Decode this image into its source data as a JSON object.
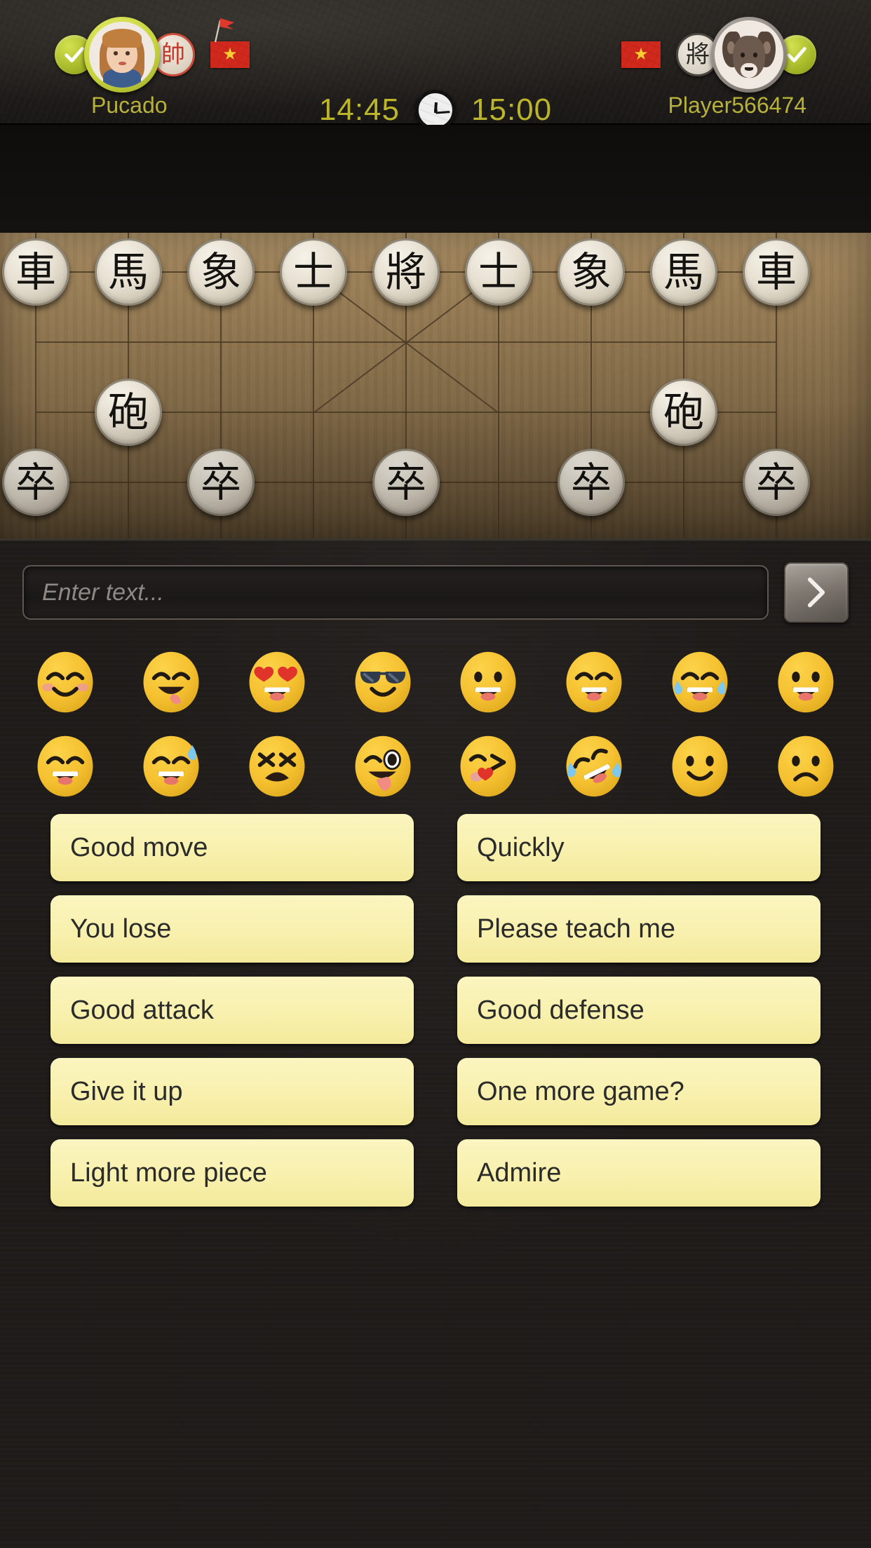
{
  "header": {
    "left_player": {
      "name": "Pucado",
      "piece_badge": "帥",
      "ready_icon": "check-icon",
      "flag": "vietnam-flag",
      "avatar": "girl-avatar",
      "pin_icon": "red-flag-pin-icon"
    },
    "right_player": {
      "name": "Player566474",
      "piece_badge": "將",
      "ready_icon": "check-icon",
      "flag": "vietnam-flag",
      "avatar": "ram-avatar"
    },
    "timers": {
      "left_time": "14:45",
      "right_time": "15:00",
      "clock_icon": "clock-icon"
    },
    "accent_color": "#b9b23a",
    "flag_color": "#d0271c"
  },
  "board": {
    "columns": 9,
    "rows": 10,
    "board_color": "#8b7049",
    "line_color": "#4b3a26",
    "pieces": [
      {
        "glyph": "車",
        "col": 0,
        "row": 0
      },
      {
        "glyph": "馬",
        "col": 1,
        "row": 0
      },
      {
        "glyph": "象",
        "col": 2,
        "row": 0
      },
      {
        "glyph": "士",
        "col": 3,
        "row": 0
      },
      {
        "glyph": "將",
        "col": 4,
        "row": 0
      },
      {
        "glyph": "士",
        "col": 5,
        "row": 0
      },
      {
        "glyph": "象",
        "col": 6,
        "row": 0
      },
      {
        "glyph": "馬",
        "col": 7,
        "row": 0
      },
      {
        "glyph": "車",
        "col": 8,
        "row": 0
      },
      {
        "glyph": "砲",
        "col": 1,
        "row": 2
      },
      {
        "glyph": "砲",
        "col": 7,
        "row": 2
      },
      {
        "glyph": "卒",
        "col": 0,
        "row": 3
      },
      {
        "glyph": "卒",
        "col": 2,
        "row": 3
      },
      {
        "glyph": "卒",
        "col": 4,
        "row": 3
      },
      {
        "glyph": "卒",
        "col": 6,
        "row": 3
      },
      {
        "glyph": "卒",
        "col": 8,
        "row": 3
      }
    ]
  },
  "chat": {
    "input_placeholder": "Enter text...",
    "send_icon": "chevron-right-icon",
    "emoji_rows": [
      [
        {
          "name": "blush-emoji"
        },
        {
          "name": "yum-emoji"
        },
        {
          "name": "heart-eyes-emoji"
        },
        {
          "name": "sunglasses-emoji"
        },
        {
          "name": "grin-emoji"
        },
        {
          "name": "laughing-emoji"
        },
        {
          "name": "joy-tears-emoji"
        },
        {
          "name": "grinning-emoji"
        }
      ],
      [
        {
          "name": "big-laugh-emoji"
        },
        {
          "name": "sweat-laugh-emoji"
        },
        {
          "name": "distraught-emoji"
        },
        {
          "name": "wink-tongue-emoji"
        },
        {
          "name": "kiss-heart-emoji"
        },
        {
          "name": "rofl-emoji"
        },
        {
          "name": "slight-smile-emoji"
        },
        {
          "name": "frown-emoji"
        }
      ]
    ],
    "phrases": [
      "Good move",
      "Quickly",
      "You lose",
      "Please teach me",
      "Good attack",
      "Good defense",
      "Give it up",
      "One more game?",
      "Light more piece",
      "Admire"
    ],
    "phrase_bg": "#f8f0ad"
  }
}
